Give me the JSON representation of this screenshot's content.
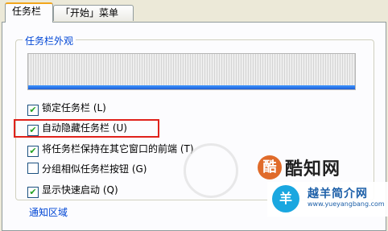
{
  "tabs": [
    {
      "label": "任务栏",
      "active": true
    },
    {
      "label": "「开始」菜单",
      "active": false
    }
  ],
  "appearance_group": {
    "title": "任务栏外观",
    "options": [
      {
        "label": "锁定任务栏 (L)",
        "checked": true
      },
      {
        "label": "自动隐藏任务栏 (U)",
        "checked": true,
        "highlighted": true
      },
      {
        "label": "将任务栏保持在其它窗口的前端 (T)",
        "checked": true
      },
      {
        "label": "分组相似任务栏按钮 (G)",
        "checked": false
      },
      {
        "label": "显示快速启动 (Q)",
        "checked": true
      }
    ]
  },
  "notification_group": {
    "title": "通知区域"
  },
  "watermarks": {
    "site_badge": "酷",
    "site_name": "酷知网",
    "corner_logo": "羊",
    "corner_name": "越羊简介网",
    "corner_url": "www.yueyangbang.com"
  },
  "colors": {
    "highlight_border": "#e0221b",
    "group_title": "#0046d5",
    "accent_tab": "#f2a61c"
  }
}
